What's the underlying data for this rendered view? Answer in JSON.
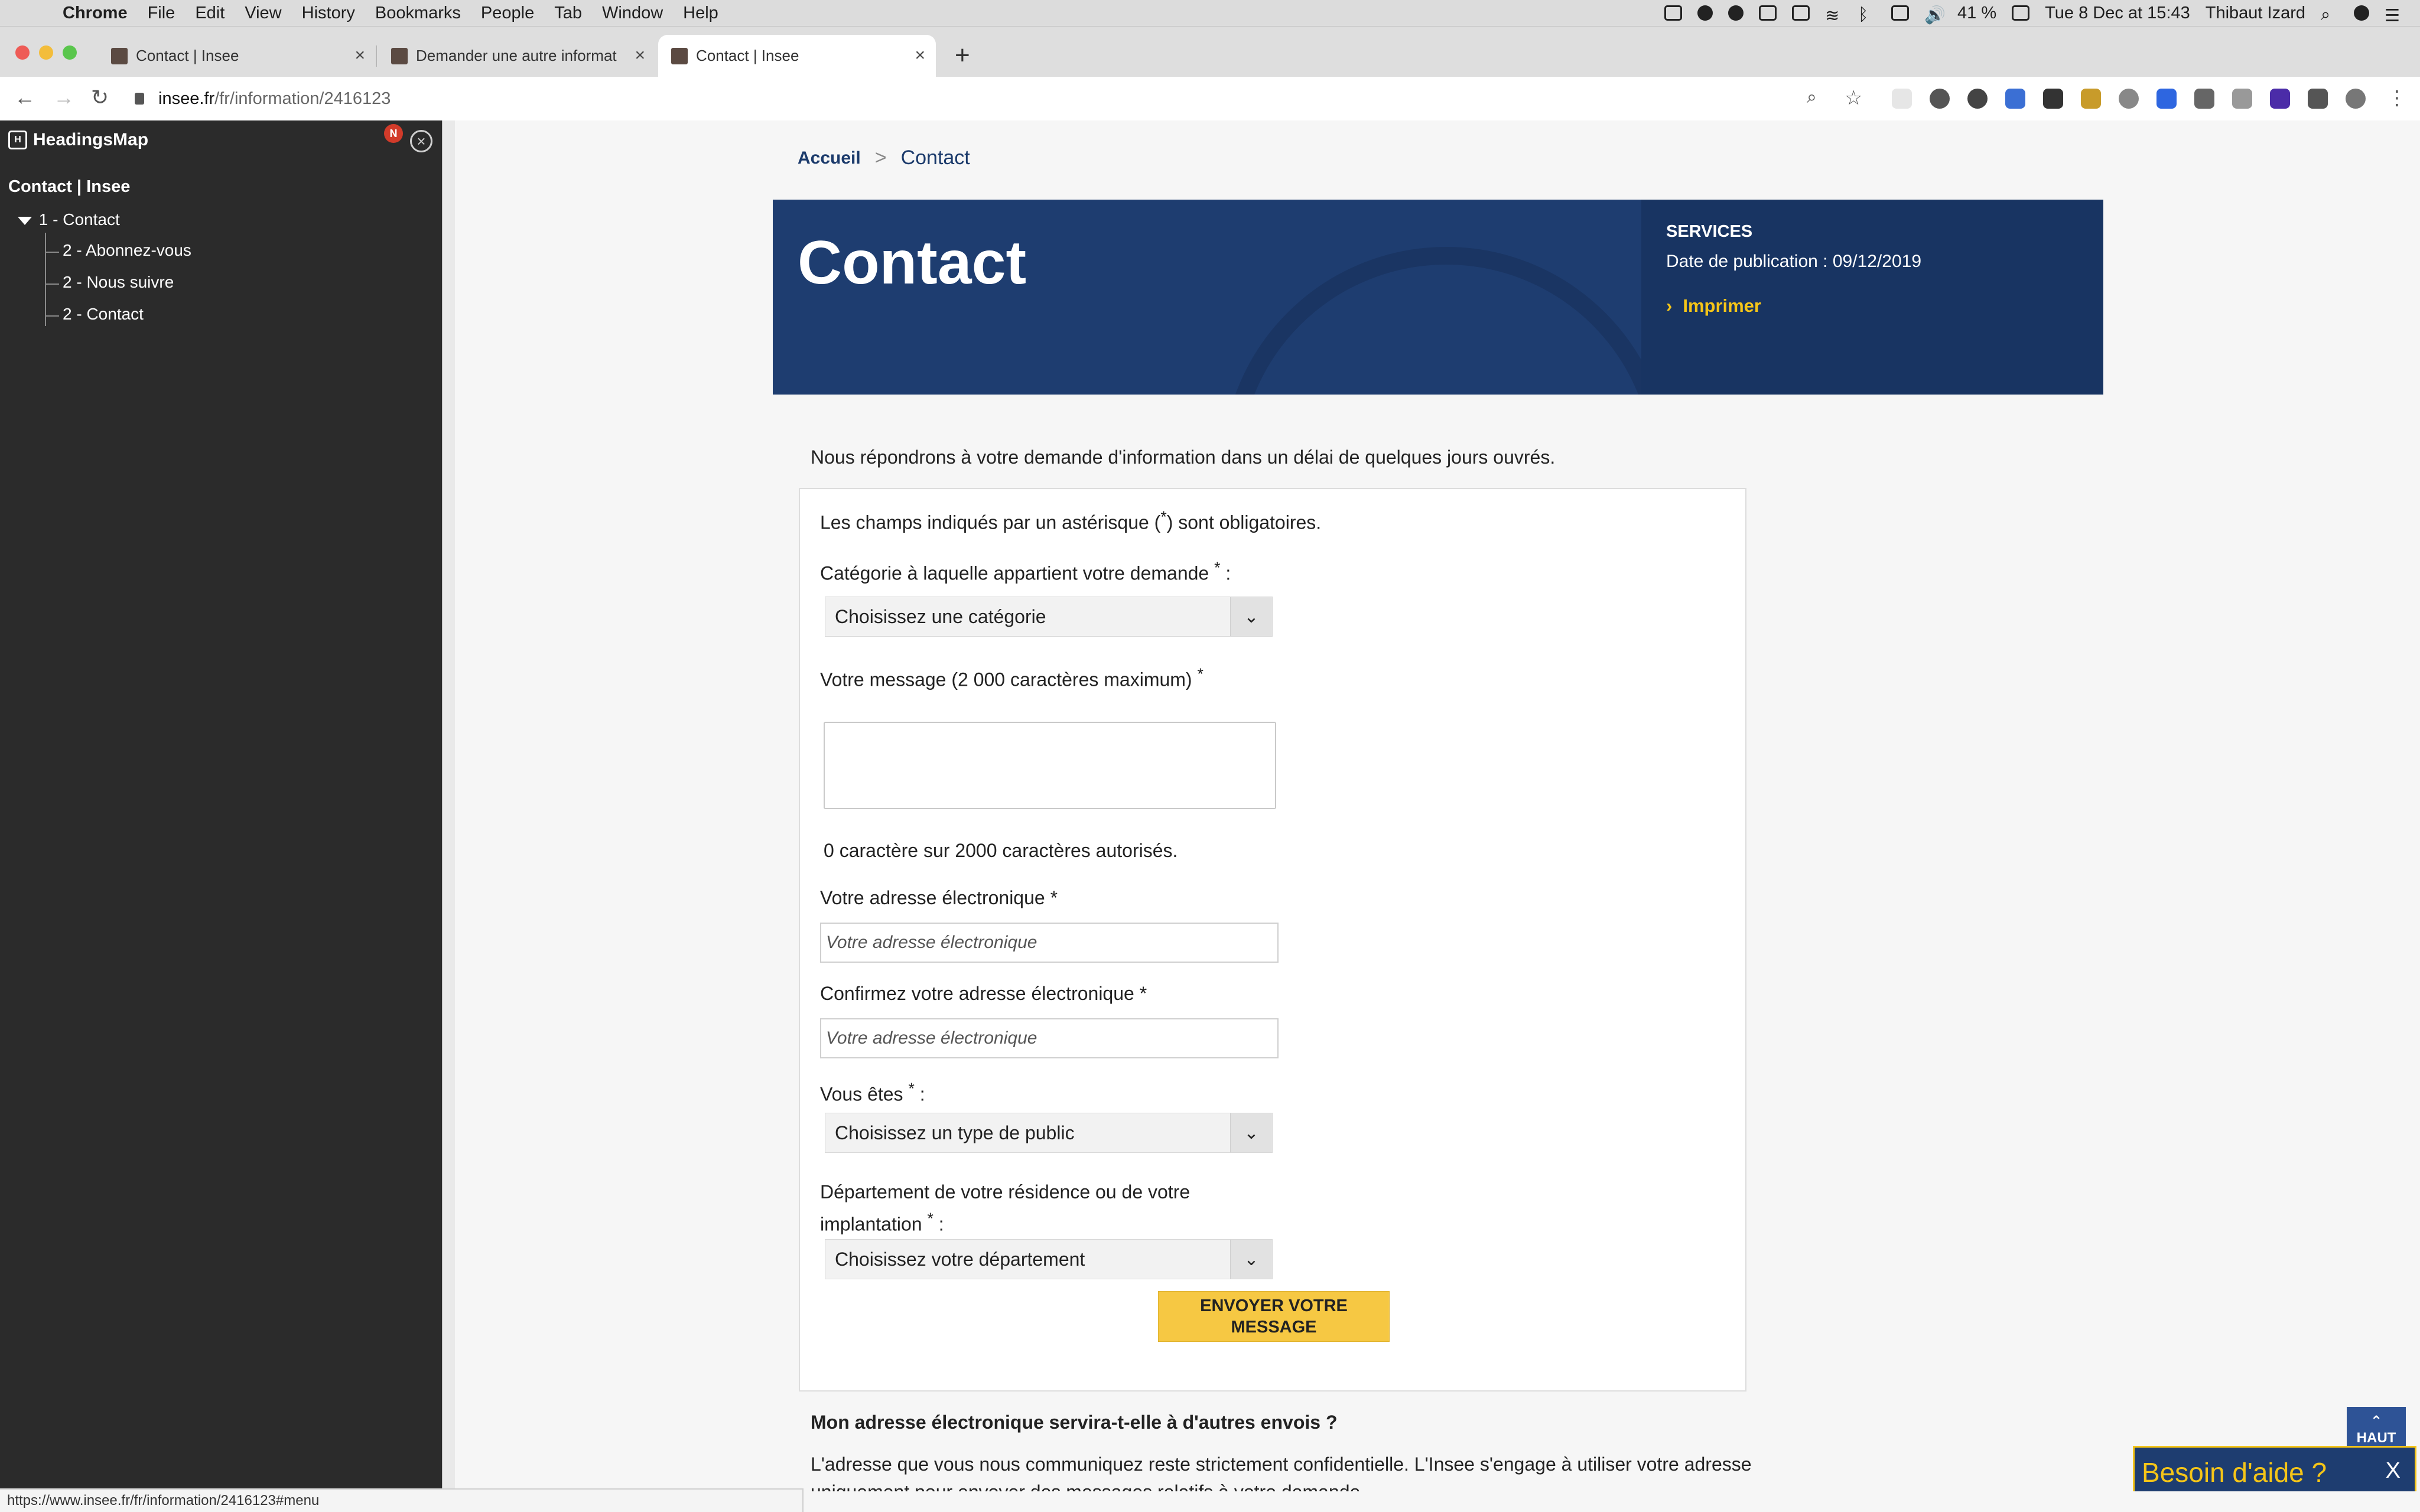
{
  "menubar": {
    "app": "Chrome",
    "menus": [
      "File",
      "Edit",
      "View",
      "History",
      "Bookmarks",
      "People",
      "Tab",
      "Window",
      "Help"
    ],
    "battery": "41 %",
    "datetime": "Tue 8 Dec at 15:43",
    "user": "Thibaut Izard"
  },
  "tabs": [
    {
      "title": "Contact | Insee"
    },
    {
      "title": "Demander une autre informatic"
    },
    {
      "title": "Contact | Insee"
    }
  ],
  "omnibox": {
    "host": "insee.fr",
    "path": "/fr/information/2416123"
  },
  "sidebar": {
    "name": "HeadingsMap",
    "badge": "N",
    "page_title": "Contact | Insee",
    "h1": "1 - Contact",
    "h2": [
      "2 - Abonnez-vous",
      "2 - Nous suivre",
      "2 - Contact"
    ]
  },
  "breadcrumb": {
    "home": "Accueil",
    "separator": ">",
    "current": "Contact"
  },
  "hero": {
    "title": "Contact",
    "kicker": "SERVICES",
    "publication": "Date de publication : 09/12/2019",
    "print": "Imprimer"
  },
  "intro": "Nous répondrons à votre demande d'information dans un délai de quelques jours ouvrés.",
  "form": {
    "required_note_a": "Les champs indiqués par un astérisque (",
    "required_note_star": "*",
    "required_note_b": ") sont obligatoires.",
    "category_label": "Catégorie à laquelle appartient votre demande",
    "category_value": "Choisissez une catégorie",
    "message_label": "Votre message (2 000 caractères maximum)",
    "char_count": "0 caractère sur 2000 caractères autorisés.",
    "email_label": "Votre adresse électronique *",
    "email_placeholder": "Votre adresse électronique",
    "confirm_label": "Confirmez votre adresse électronique *",
    "confirm_placeholder": "Votre adresse électronique",
    "public_label": "Vous êtes",
    "public_value": "Choisissez un type de public",
    "dept_label_1": "Département de votre résidence ou de votre",
    "dept_label_2": "implantation",
    "dept_value": "Choisissez votre département",
    "submit_1": "ENVOYER VOTRE",
    "submit_2": "MESSAGE"
  },
  "faq": {
    "question": "Mon adresse électronique servira-t-elle à d'autres envois ?",
    "answer": "L'adresse que vous nous communiquez reste strictement confidentielle. L'Insee s'engage à utiliser votre adresse uniquement pour envoyer des messages relatifs à votre demande."
  },
  "top_button": "HAUT",
  "help": {
    "label": "Besoin d'aide ?",
    "close": "X"
  },
  "status_url": "https://www.insee.fr/fr/information/2416123#menu",
  "colors": {
    "brand_blue": "#1e3d70",
    "accent_yellow": "#f5c518",
    "sidebar_bg": "#2b2b2b"
  }
}
